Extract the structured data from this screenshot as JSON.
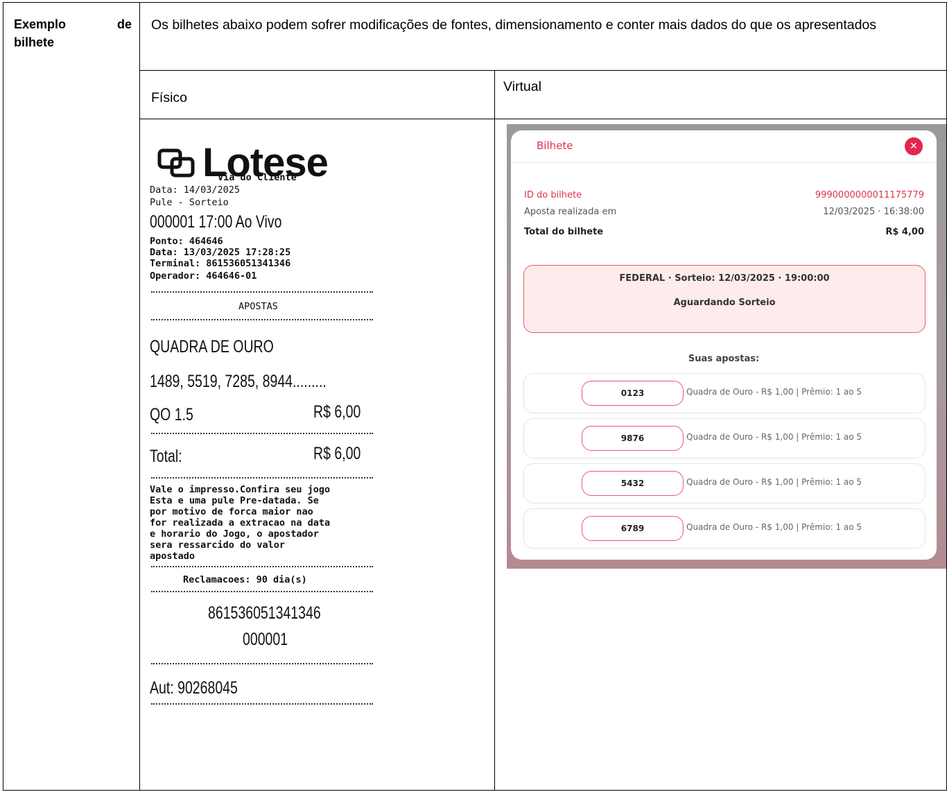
{
  "table": {
    "label_line1_left": "Exemplo",
    "label_line1_right": "de",
    "label_line2": "bilhete",
    "description": "Os bilhetes abaixo podem sofrer modificações de fontes, dimensionamento e conter mais dados do que os apresentados",
    "col_physical": "Físico",
    "col_virtual": "Virtual"
  },
  "receipt": {
    "logo_text": "Lotese",
    "via": "Via do Cliente",
    "data": "Data: 14/03/2025",
    "pule": "Pule - Sorteio",
    "draw": "000001 17:00 Ao Vivo",
    "ponto": "Ponto: 464646",
    "data_hora": "Data: 13/03/2025 17:28:25",
    "terminal": "Terminal: 861536051341346",
    "operador": "Operador: 464646-01",
    "apostas_header": "APOSTAS",
    "modalidade": "QUADRA DE OURO",
    "numeros": "1489, 5519, 7285, 8944.........",
    "qo_label": "QO 1.5",
    "qo_value": "R$ 6,00",
    "total_label": "Total:",
    "total_value": "R$ 6,00",
    "aviso": [
      "Vale o impresso.Confira seu jogo",
      "Esta e uma pule Pre-datada. Se",
      "por motivo de forca maior nao",
      "for realizada a extracao na data",
      "e horario do Jogo, o apostador",
      "sera ressarcido do valor",
      "apostado"
    ],
    "reclamacoes": "Reclamacoes: 90 dia(s)",
    "codigo1": "861536051341346",
    "codigo2": "000001",
    "aut": "Aut: 90268045"
  },
  "virtual": {
    "title": "Bilhete",
    "close_icon": "close-icon",
    "id_label": "ID do bilhete",
    "id_value": "9990000000011175779",
    "aposta_label": "Aposta realizada em",
    "aposta_value": "12/03/2025 · 16:38:00",
    "total_label": "Total do bilhete",
    "total_value": "R$ 4,00",
    "draw_line": "FEDERAL · Sorteio: 12/03/2025 · 19:00:00",
    "status": "Aguardando Sorteio",
    "suas_apostas": "Suas apostas:",
    "bets": [
      {
        "number": "0123",
        "desc": "Quadra de Ouro - R$ 1,00 | Prêmio: 1 ao 5"
      },
      {
        "number": "9876",
        "desc": "Quadra de Ouro - R$ 1,00 | Prêmio: 1 ao 5"
      },
      {
        "number": "5432",
        "desc": "Quadra de Ouro - R$ 1,00 | Prêmio: 1 ao 5"
      },
      {
        "number": "6789",
        "desc": "Quadra de Ouro - R$ 1,00 | Prêmio: 1 ao 5"
      }
    ],
    "accent_color": "#e5264d"
  }
}
